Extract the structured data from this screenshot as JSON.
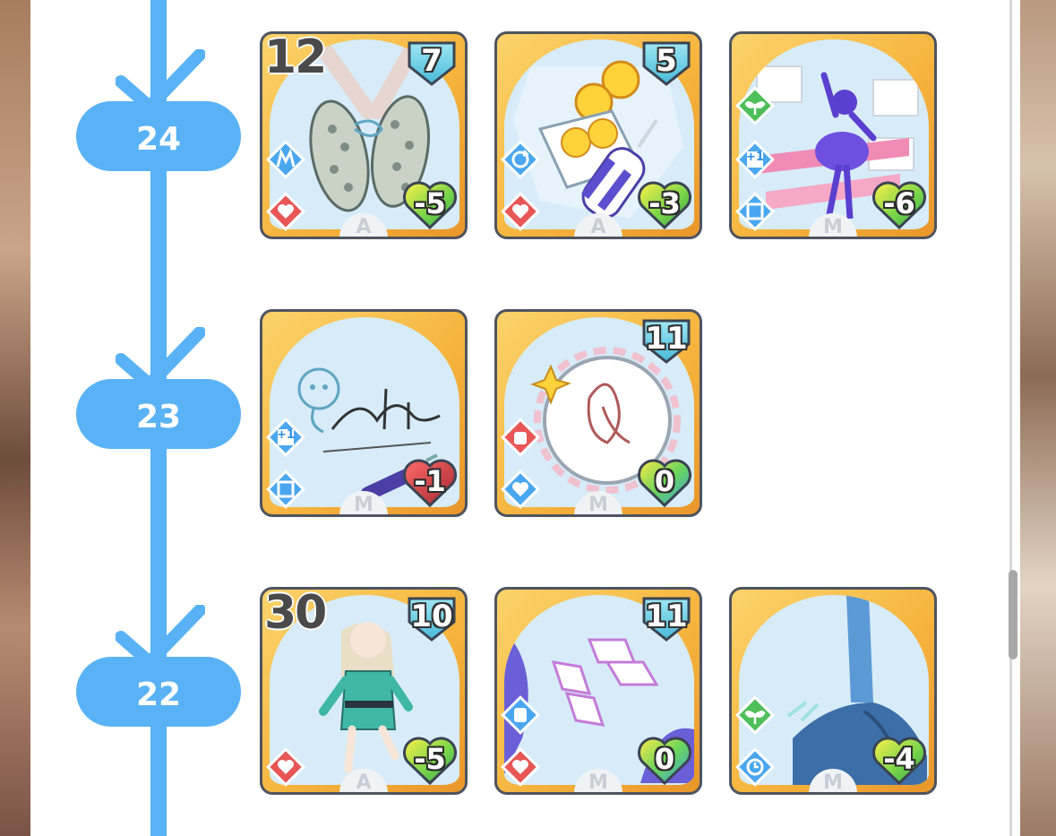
{
  "colors": {
    "timeline": "#59b2f5",
    "card_border": "#4e545f",
    "card_gold": "#f6b53e",
    "art_bg": "#d7ecf8",
    "cost_cyan": "#6fd0e8",
    "badge_blue": "#4aa7ef",
    "badge_red": "#e85656",
    "badge_green": "#4fbf5a"
  },
  "levels": [
    {
      "level": "24",
      "cards": [
        {
          "count": "12",
          "cost": "7",
          "heart": "-5",
          "heart_color": "green-yellow",
          "rarity": "A",
          "art": "sneakers",
          "badges": [
            "m-badge-icon",
            "heart-break-badge-icon"
          ]
        },
        {
          "count": "",
          "cost": "5",
          "heart": "-3",
          "heart_color": "green-yellow",
          "rarity": "A",
          "art": "drink-bottle-oranges",
          "badges": [
            "cycle-badge-icon",
            "heart-break-badge-icon"
          ]
        },
        {
          "count": "",
          "cost": "",
          "heart": "-6",
          "heart_color": "green-yellow",
          "rarity": "M",
          "art": "dancer-silhouette",
          "badges": [
            "sprout-badge-icon",
            "plus-one-badge",
            "square-badge-icon"
          ]
        }
      ]
    },
    {
      "level": "23",
      "cards": [
        {
          "count": "",
          "cost": "",
          "heart": "-1",
          "heart_color": "red",
          "rarity": "M",
          "art": "autograph-pen",
          "badges": [
            "plus-one-badge",
            "square-badge-icon"
          ],
          "plus_label": "+1"
        },
        {
          "count": "",
          "cost": "11",
          "heart": "0",
          "heart_color": "rainbow",
          "rarity": "M",
          "art": "tambourine",
          "badges": [
            "fist-x-badge-icon",
            "heart-plus-badge-icon"
          ]
        }
      ]
    },
    {
      "level": "22",
      "cards": [
        {
          "count": "30",
          "cost": "10",
          "heart": "-5",
          "heart_color": "green-yellow",
          "rarity": "A",
          "art": "running-girl",
          "badges": [
            "heart-break-badge-icon"
          ]
        },
        {
          "count": "",
          "cost": "11",
          "heart": "0",
          "heart_color": "rainbow",
          "rarity": "M",
          "art": "crystal-shards",
          "badges": [
            "fist-badge-icon",
            "heart-break-badge-icon"
          ]
        },
        {
          "count": "",
          "cost": "",
          "heart": "-4",
          "heart_color": "green-yellow",
          "rarity": "M",
          "art": "kick-leg",
          "badges": [
            "sprout-badge-icon",
            "clock-badge-icon"
          ]
        }
      ]
    }
  ]
}
